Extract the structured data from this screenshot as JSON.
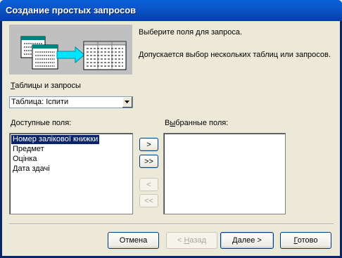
{
  "window": {
    "title": "Создание простых запросов"
  },
  "intro": {
    "line1": "Выберите поля для запроса.",
    "line2": "Допускается выбор нескольких таблиц или запросов."
  },
  "tables": {
    "label_underlined": "Т",
    "label_rest": "аблицы и запросы",
    "selected": "Таблица: Іспити"
  },
  "available": {
    "label_underlined": "Д",
    "label_rest": "оступные поля:",
    "items": [
      "Номер залікової книжки",
      "Предмет",
      "Оцінка",
      "Дата здачі"
    ],
    "selected_index": 0
  },
  "selected_fields": {
    "label_pre": "В",
    "label_underlined": "ы",
    "label_rest": "бранные поля:",
    "items": []
  },
  "move_buttons": {
    "add_one": ">",
    "add_all": ">>",
    "remove_one": "<",
    "remove_all": "<<"
  },
  "footer": {
    "cancel": "Отмена",
    "back_pre": "< ",
    "back_underlined": "Н",
    "back_rest": "азад",
    "next_underlined": "Д",
    "next_rest": "алее >",
    "finish_underlined": "Г",
    "finish_rest": "отово"
  },
  "icons": {
    "combo": "chevron-down-icon",
    "illustration": "tables-to-query-illustration"
  }
}
